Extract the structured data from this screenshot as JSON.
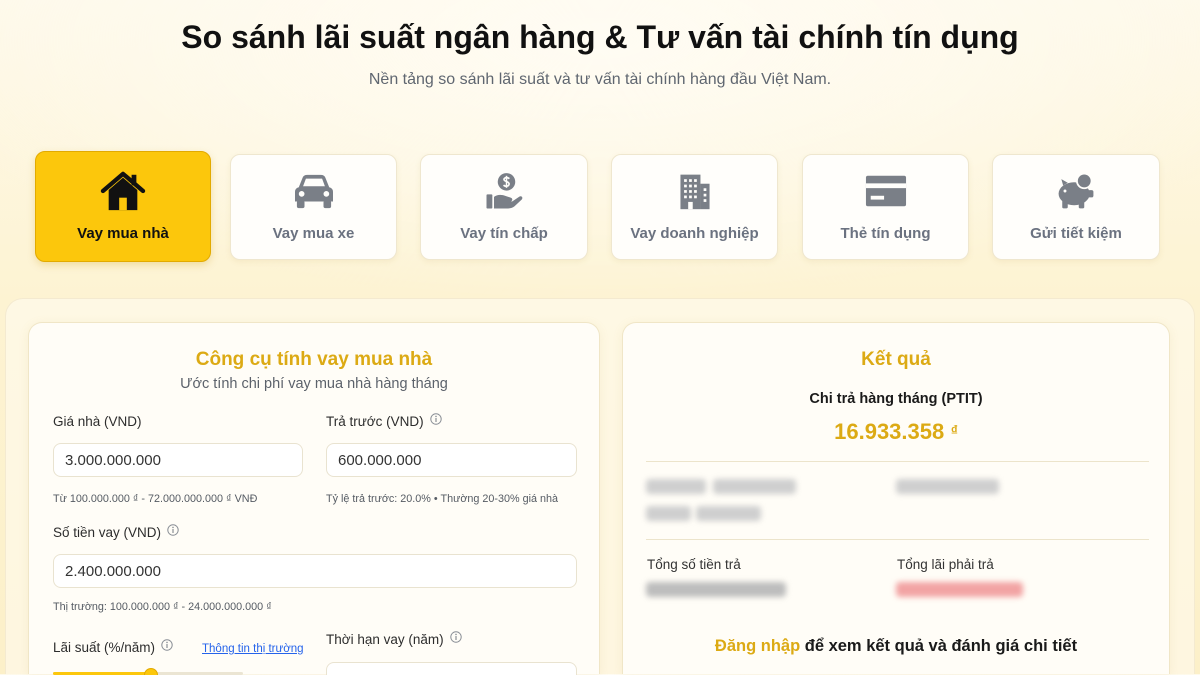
{
  "header": {
    "title": "So sánh lãi suất ngân hàng & Tư vấn tài chính tín dụng",
    "subtitle": "Nền tảng so sánh lãi suất và tư vấn tài chính hàng đầu Việt Nam."
  },
  "tabs": [
    {
      "label": "Vay mua nhà",
      "icon": "house-icon",
      "active": true
    },
    {
      "label": "Vay mua xe",
      "icon": "car-icon",
      "active": false
    },
    {
      "label": "Vay tín chấp",
      "icon": "hand-coin-icon",
      "active": false
    },
    {
      "label": "Vay doanh nghiệp",
      "icon": "building-icon",
      "active": false
    },
    {
      "label": "Thẻ tín dụng",
      "icon": "credit-card-icon",
      "active": false
    },
    {
      "label": "Gửi tiết kiệm",
      "icon": "piggy-bank-icon",
      "active": false
    }
  ],
  "calculator": {
    "title": "Công cụ tính vay mua nhà",
    "subtitle": "Ước tính chi phí vay mua nhà hàng tháng",
    "house_price": {
      "label": "Giá nhà (VND)",
      "value": "3.000.000.000",
      "hint": "Từ 100.000.000 ₫ - 72.000.000.000 ₫ VNĐ"
    },
    "down_payment": {
      "label": "Trả trước (VND)",
      "value": "600.000.000",
      "hint": "Tỷ lệ trả trước: 20.0% • Thường 20-30% giá nhà"
    },
    "loan_amount": {
      "label": "Số tiền vay (VND)",
      "value": "2.400.000.000",
      "hint": "Thị trường: 100.000.000 ₫ - 24.000.000.000 ₫"
    },
    "interest_rate": {
      "label": "Lãi suất (%/năm)",
      "link": "Thông tin thị trường"
    },
    "loan_term": {
      "label": "Thời hạn vay (năm)"
    }
  },
  "result": {
    "title": "Kết quả",
    "monthly_label": "Chi trả hàng tháng (PTIT)",
    "monthly_value": "16.933.358",
    "currency": "₫",
    "total_paid_label": "Tổng số tiền trả",
    "total_interest_label": "Tổng lãi phải trả",
    "login_link": "Đăng nhập",
    "login_text": " để xem kết quả và đánh giá chi tiết"
  },
  "colors": {
    "accent": "#fcc70c",
    "gold_text": "#dcaa14",
    "link": "#2563eb",
    "inactive_icon": "#7a7f87"
  }
}
